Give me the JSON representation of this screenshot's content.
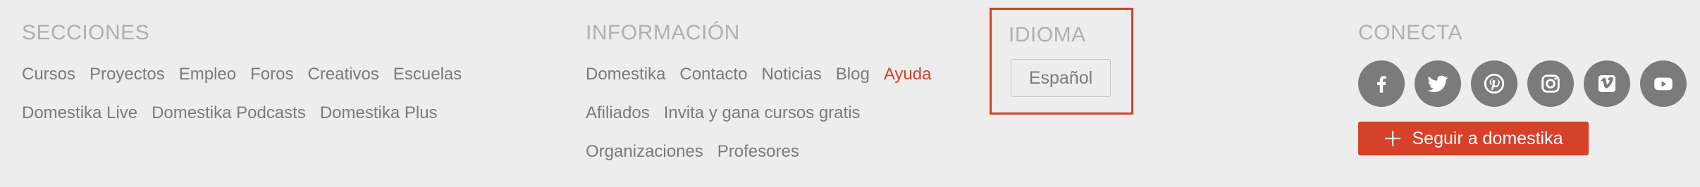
{
  "secciones": {
    "heading": "SECCIONES",
    "row1": [
      "Cursos",
      "Proyectos",
      "Empleo",
      "Foros",
      "Creativos",
      "Escuelas"
    ],
    "row2": [
      "Domestika Live",
      "Domestika Podcasts",
      "Domestika Plus"
    ]
  },
  "informacion": {
    "heading": "INFORMACIÓN",
    "row1": [
      "Domestika",
      "Contacto",
      "Noticias",
      "Blog",
      "Ayuda"
    ],
    "row2": [
      "Afiliados",
      "Invita y gana cursos gratis"
    ],
    "row3": [
      "Organizaciones",
      "Profesores"
    ]
  },
  "idioma": {
    "heading": "IDIOMA",
    "language": "Español"
  },
  "conecta": {
    "heading": "CONECTA",
    "social_icons": [
      "facebook-icon",
      "twitter-icon",
      "pinterest-icon",
      "instagram-icon",
      "vimeo-icon",
      "youtube-icon"
    ],
    "follow_label": "Seguir a domestika"
  },
  "colors": {
    "accent": "#d5412b",
    "text": "#7b7b7b",
    "heading": "#b0b0b0",
    "background": "#ededed"
  }
}
